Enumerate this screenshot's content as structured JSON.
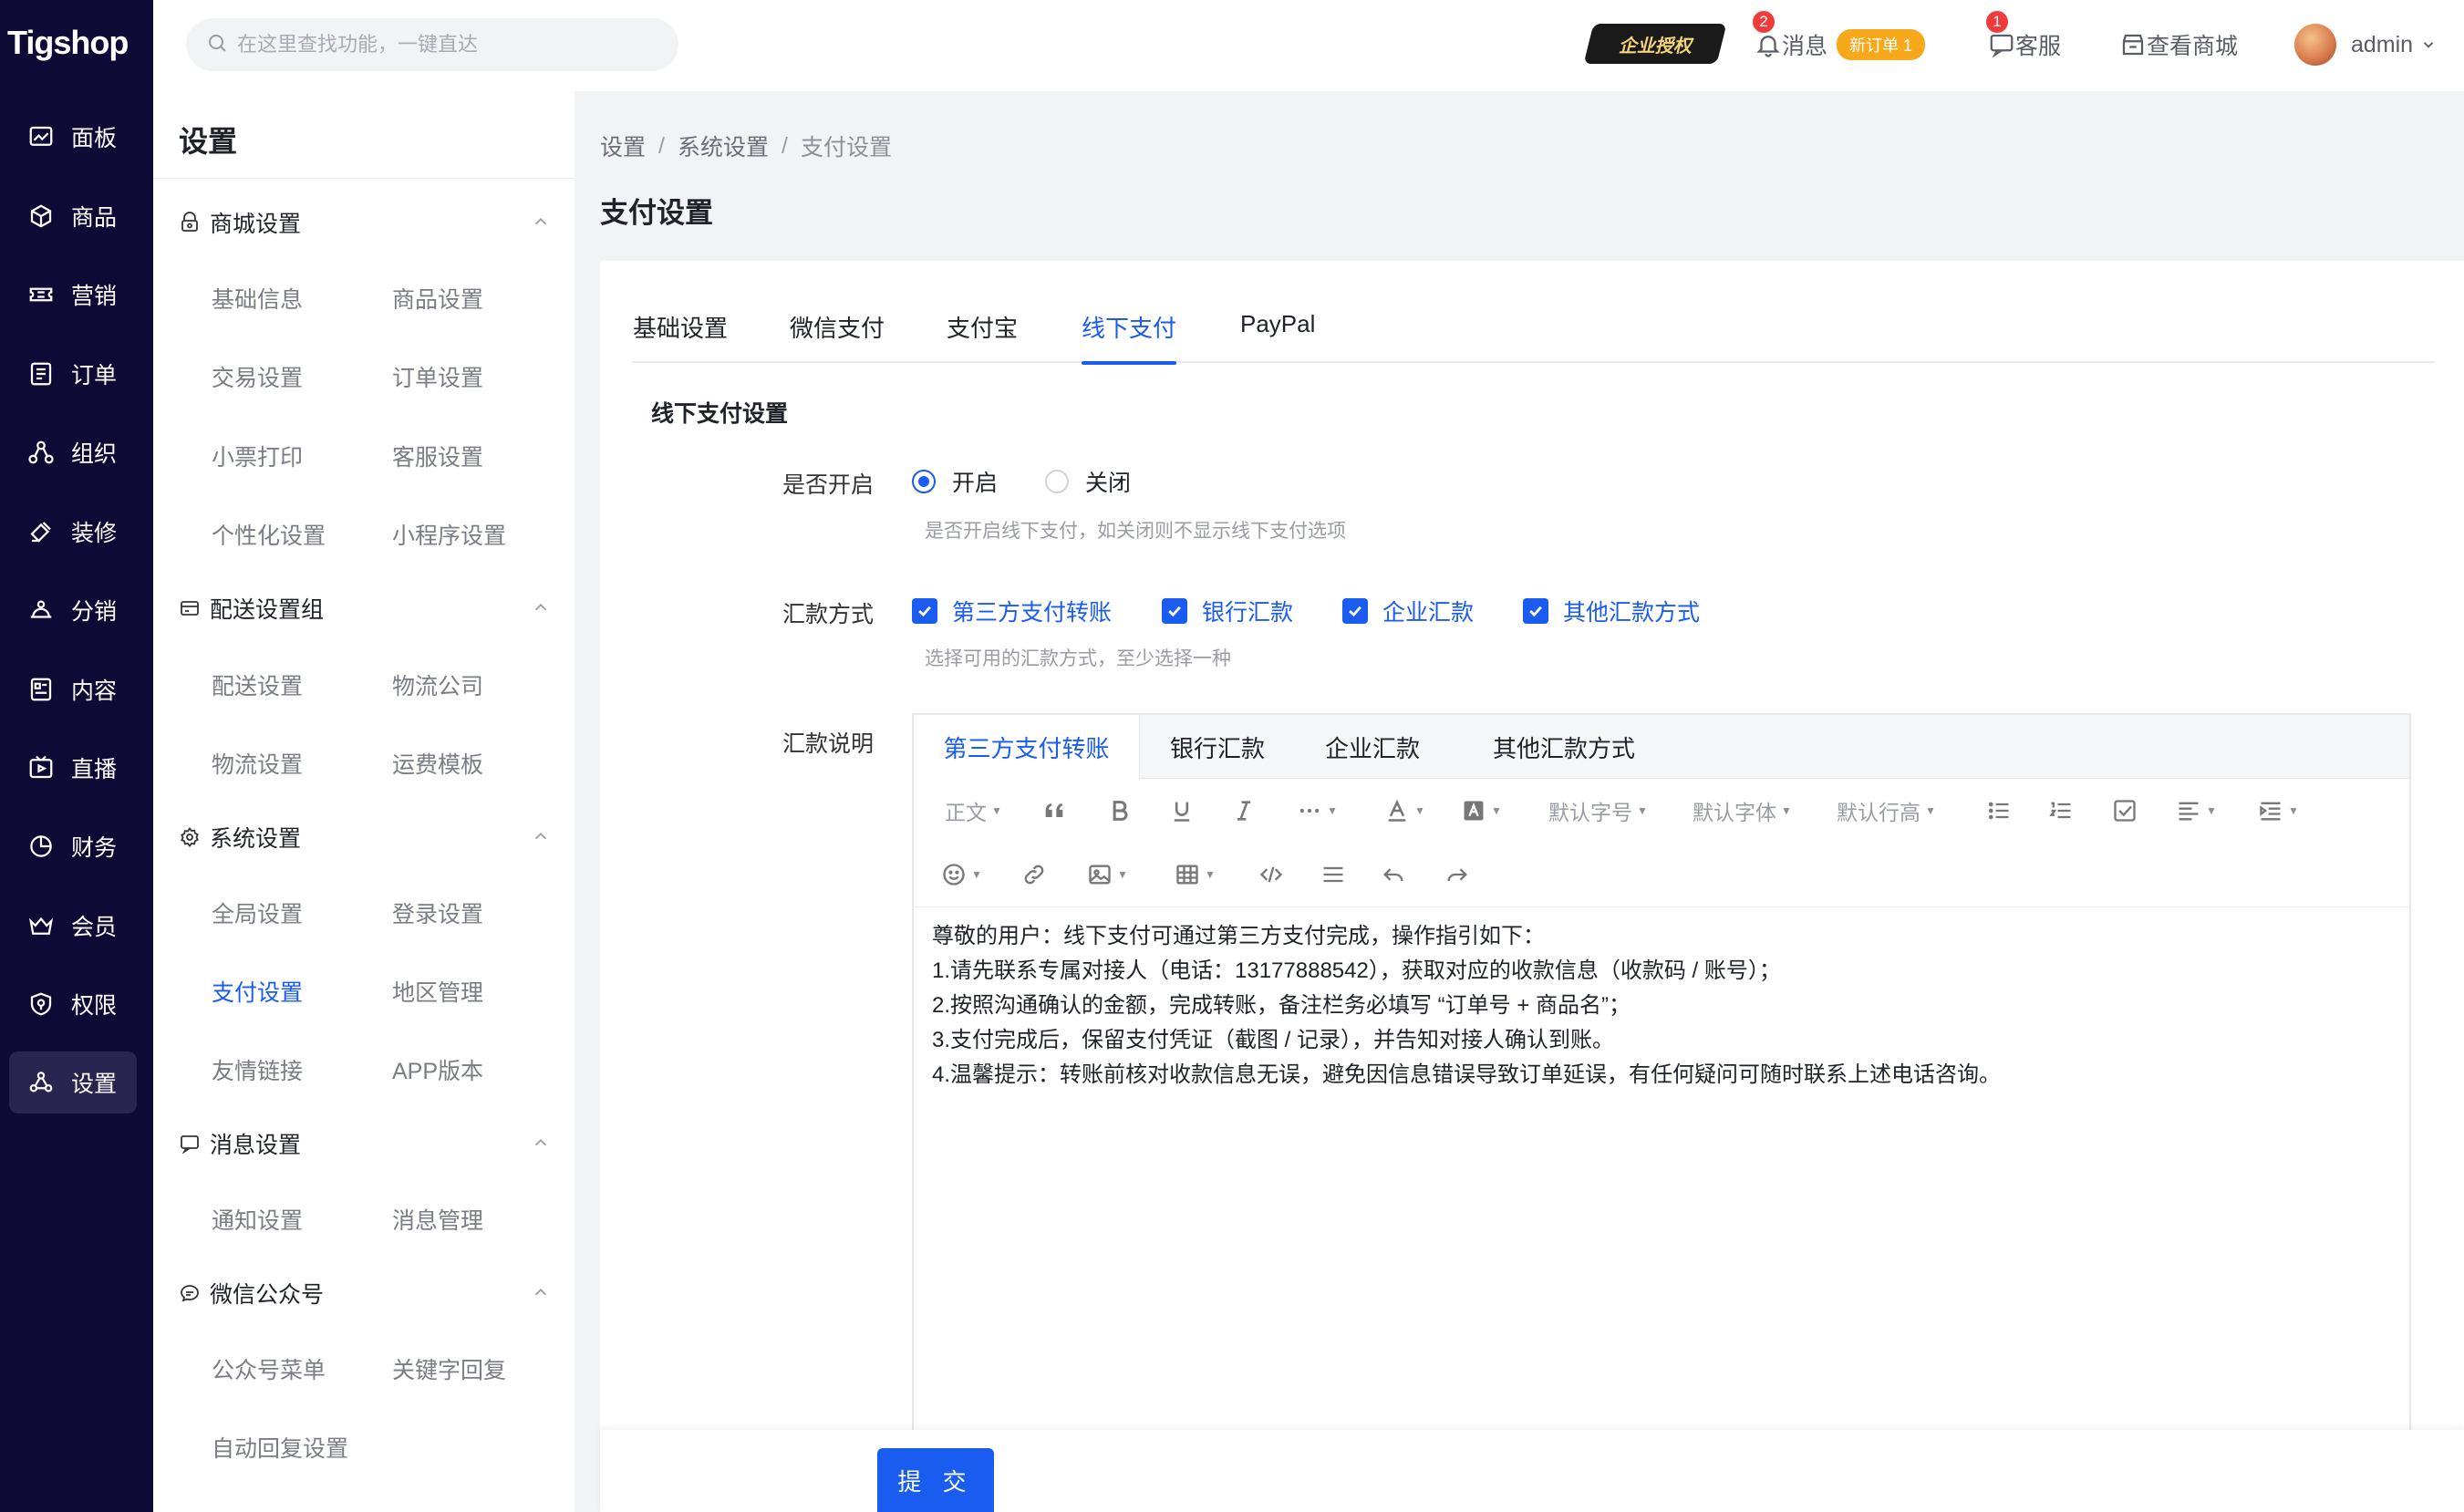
{
  "brand": {
    "logo": "Tigshop"
  },
  "nav": [
    {
      "label": "面板",
      "icon": "dashboard-icon"
    },
    {
      "label": "商品",
      "icon": "box-icon"
    },
    {
      "label": "营销",
      "icon": "ticket-icon"
    },
    {
      "label": "订单",
      "icon": "order-icon"
    },
    {
      "label": "组织",
      "icon": "org-icon"
    },
    {
      "label": "装修",
      "icon": "brush-icon"
    },
    {
      "label": "分销",
      "icon": "share-icon"
    },
    {
      "label": "内容",
      "icon": "content-icon"
    },
    {
      "label": "直播",
      "icon": "live-icon"
    },
    {
      "label": "财务",
      "icon": "finance-icon"
    },
    {
      "label": "会员",
      "icon": "crown-icon"
    },
    {
      "label": "权限",
      "icon": "shield-icon"
    },
    {
      "label": "设置",
      "icon": "settings-icon"
    }
  ],
  "header": {
    "search_placeholder": "在这里查找功能，一键直达",
    "auth_badge": "企业授权",
    "messages": {
      "label": "消息",
      "count": "2",
      "new_order": "新订单 1"
    },
    "service": {
      "label": "客服",
      "count": "1"
    },
    "view_store": "查看商城",
    "user": "admin"
  },
  "subnav": {
    "title": "设置",
    "groups": [
      {
        "title": "商城设置",
        "icon": "store-settings-icon",
        "items": [
          "基础信息",
          "商品设置",
          "交易设置",
          "订单设置",
          "小票打印",
          "客服设置",
          "个性化设置",
          "小程序设置"
        ]
      },
      {
        "title": "配送设置组",
        "icon": "delivery-icon",
        "items": [
          "配送设置",
          "物流公司",
          "物流设置",
          "运费模板"
        ]
      },
      {
        "title": "系统设置",
        "icon": "gear-icon",
        "items": [
          "全局设置",
          "登录设置",
          "支付设置",
          "地区管理",
          "友情链接",
          "APP版本"
        ]
      },
      {
        "title": "消息设置",
        "icon": "message-settings-icon",
        "items": [
          "通知设置",
          "消息管理"
        ]
      },
      {
        "title": "微信公众号",
        "icon": "wechat-icon",
        "items": [
          "公众号菜单",
          "关键字回复",
          "自动回复设置"
        ]
      }
    ]
  },
  "breadcrumb": [
    "设置",
    "系统设置",
    "支付设置"
  ],
  "page_title": "支付设置",
  "tabs": [
    "基础设置",
    "微信支付",
    "支付宝",
    "线下支付",
    "PayPal"
  ],
  "section_title": "线下支付设置",
  "form": {
    "enable": {
      "label": "是否开启",
      "options": [
        "开启",
        "关闭"
      ],
      "selected": "开启",
      "hint": "是否开启线下支付，如关闭则不显示线下支付选项"
    },
    "methods": {
      "label": "汇款方式",
      "options": [
        "第三方支付转账",
        "银行汇款",
        "企业汇款",
        "其他汇款方式"
      ],
      "hint": "选择可用的汇款方式，至少选择一种"
    },
    "desc": {
      "label": "汇款说明"
    }
  },
  "editor": {
    "tabs": [
      "第三方支付转账",
      "银行汇款",
      "企业汇款",
      "其他汇款方式"
    ],
    "toolbar": {
      "paragraph": "正文",
      "fontsize": "默认字号",
      "fontfamily": "默认字体",
      "lineheight": "默认行高"
    },
    "content": [
      "尊敬的用户：线下支付可通过第三方支付完成，操作指引如下：",
      "1.请先联系专属对接人（电话：13177888542），获取对应的收款信息（收款码 / 账号）；",
      "2.按照沟通确认的金额，完成转账，备注栏务必填写 “订单号 + 商品名”；",
      "3.支付完成后，保留支付凭证（截图 / 记录），并告知对接人确认到账。",
      "4.温馨提示：转账前核对收款信息无误，避免因信息错误导致订单延误，有任何疑问可随时联系上述电话咨询。"
    ]
  },
  "submit_label": "提 交",
  "colors": {
    "primary": "#1a5bf0",
    "nav_bg": "#0f0a35",
    "badge": "#f03b3b",
    "new_order": "#f7a81b"
  }
}
